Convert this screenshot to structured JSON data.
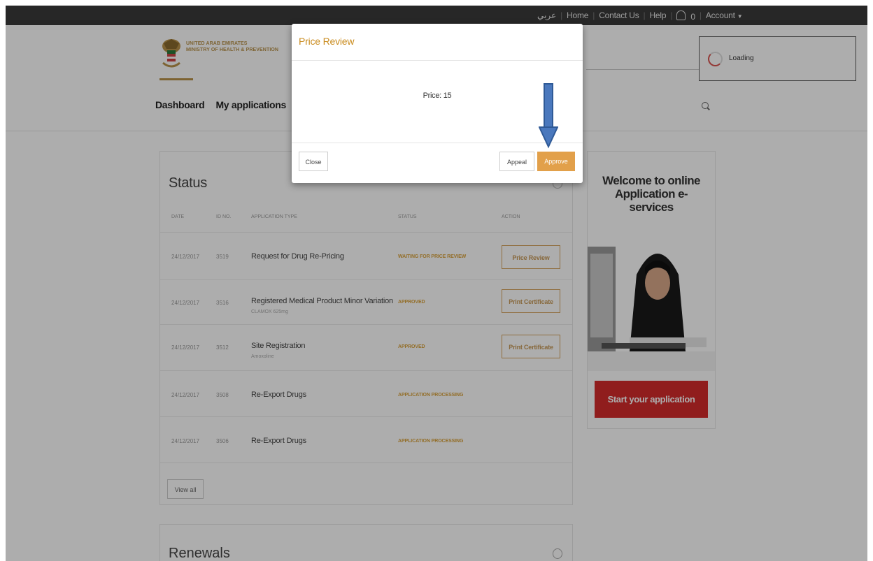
{
  "topbar": {
    "arabic_label": "عربي",
    "home": "Home",
    "contact": "Contact Us",
    "help": "Help",
    "notifications_count": "0",
    "account": "Account"
  },
  "header": {
    "logo_line1": "UNITED ARAB EMIRATES",
    "logo_line2": "MINISTRY OF HEALTH & PREVENTION",
    "nav": [
      "Dashboard",
      "My applications"
    ],
    "loading": "Loading"
  },
  "status": {
    "title": "Status",
    "columns": [
      "DATE",
      "ID NO.",
      "APPLICATION TYPE",
      "STATUS",
      "ACTION"
    ],
    "rows": [
      {
        "date": "24/12/2017",
        "id": "3519",
        "type": "Request for Drug Re-Pricing",
        "sub": "",
        "status": "WAITING FOR PRICE REVIEW",
        "action": "Price Review"
      },
      {
        "date": "24/12/2017",
        "id": "3516",
        "type": "Registered Medical Product Minor Variation",
        "sub": "CLAMOX 625mg",
        "status": "APPROVED",
        "action": "Print Certificate"
      },
      {
        "date": "24/12/2017",
        "id": "3512",
        "type": "Site Registration",
        "sub": "Amoxoline",
        "status": "APPROVED",
        "action": "Print Certificate"
      },
      {
        "date": "24/12/2017",
        "id": "3508",
        "type": "Re-Export Drugs",
        "sub": "",
        "status": "APPLICATION PROCESSING",
        "action": ""
      },
      {
        "date": "24/12/2017",
        "id": "3506",
        "type": "Re-Export Drugs",
        "sub": "",
        "status": "APPLICATION PROCESSING",
        "action": ""
      }
    ],
    "view_all": "View all"
  },
  "renewals": {
    "title": "Renewals"
  },
  "welcome": {
    "title": "Welcome to online Application e-services",
    "cta": "Start your application"
  },
  "modal": {
    "title": "Price Review",
    "price_label": "Price:",
    "price_value": "15",
    "close": "Close",
    "appeal": "Appeal",
    "approve": "Approve"
  },
  "colors": {
    "accent": "#c98b1d",
    "approve": "#e2a04a",
    "cta": "#d52b2b",
    "arrow": "#3d6fb6"
  }
}
